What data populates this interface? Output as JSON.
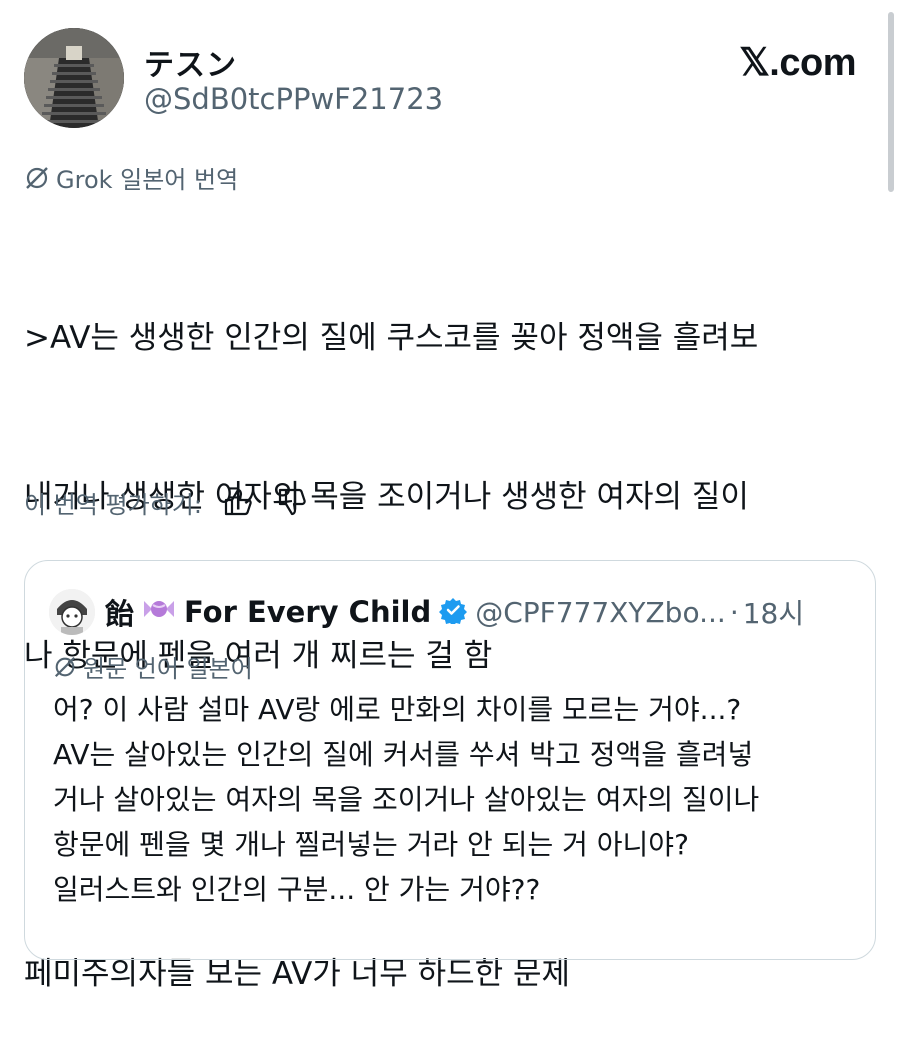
{
  "author": {
    "display_name": "テスン",
    "handle": "@SdB0tcPPwF21723"
  },
  "site_logo": "𝕏.com",
  "translation_label": "Grok 일본어 번역",
  "tweet_lines": [
    ">AV는 생생한 인간의 질에 쿠스코를 꽂아 정액을 흘려보",
    "내거나 생생한 여자의 목을 조이거나 생생한 여자의 질이",
    "나 항문에 펜을 여러 개 찌르는 걸 함",
    "",
    "페미주의자들 보는 AV가 너무 하드한 문제"
  ],
  "rate_prompt": "이 번역 평가하기:",
  "quote": {
    "display_name_prefix": "飴",
    "display_name": "For Every Child",
    "handle": "@CPF777XYZbo...",
    "separator": "·",
    "time": "18시",
    "lang_label": "원문 언어 일본어",
    "lines": [
      "어? 이 사람 설마 AV랑 에로 만화의 차이를 모르는 거야...?",
      "AV는 살아있는 인간의 질에 커서를 쑤셔 박고 정액을 흘려넣",
      "거나 살아있는 여자의 목을 조이거나 살아있는 여자의 질이나",
      "항문에 펜을 몇 개나 찔러넣는 거라 안 되는 거 아니야?",
      "일러스트와 인간의 구분... 안 가는 거야??"
    ]
  },
  "colors": {
    "text": "#0f1419",
    "secondary": "#536471",
    "verified": "#1d9bf0",
    "border": "#cfd9de"
  }
}
